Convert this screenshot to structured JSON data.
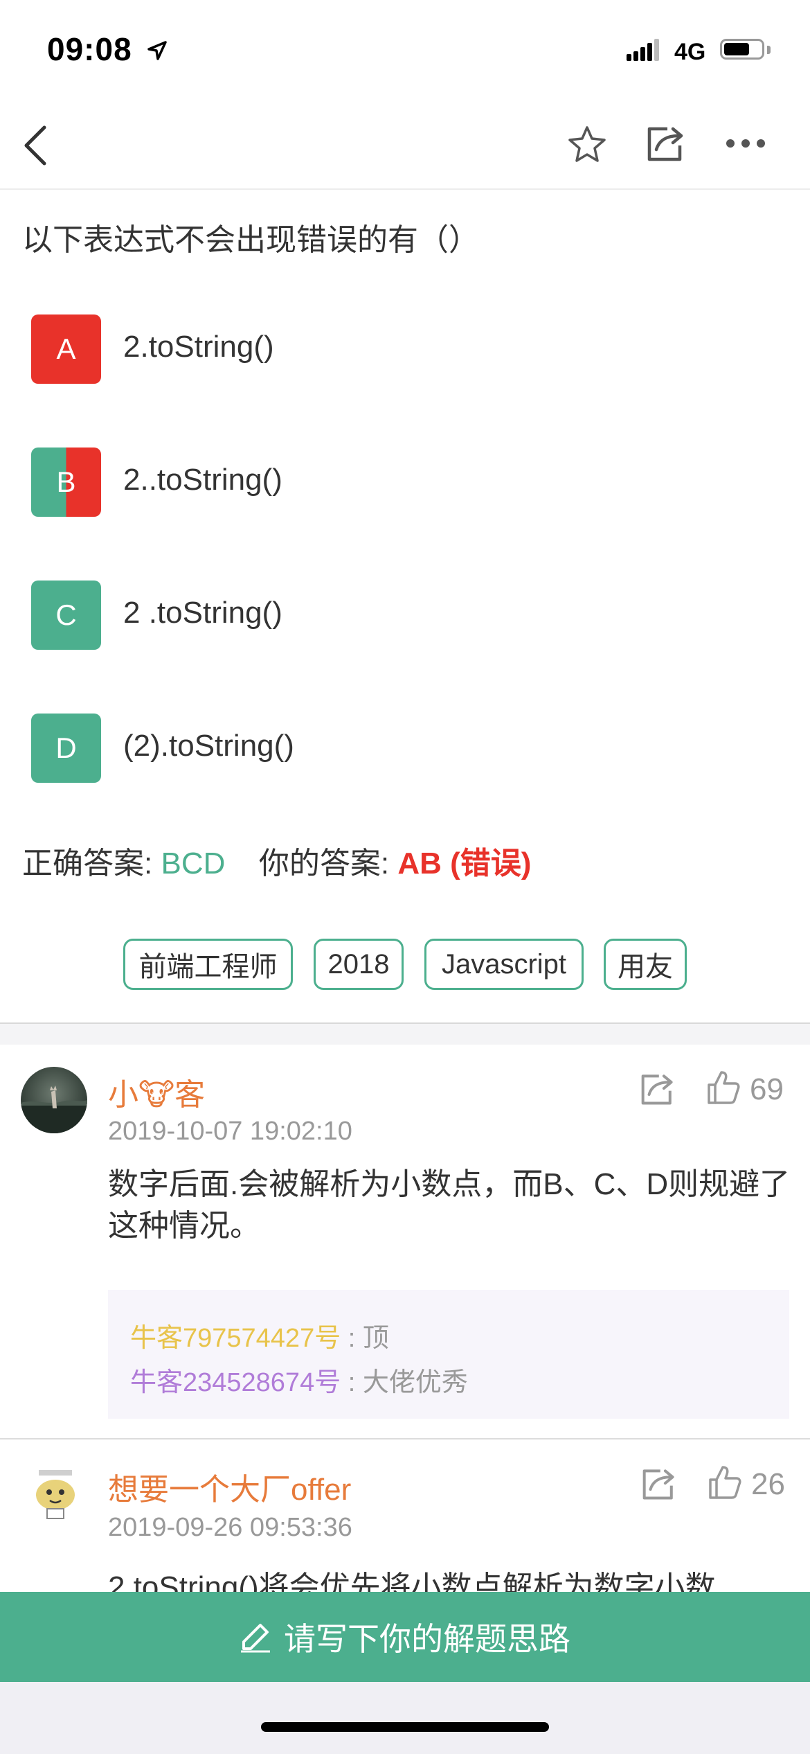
{
  "status_bar": {
    "time": "09:08",
    "network": "4G"
  },
  "nav": {
    "icons": [
      "back-icon",
      "star-icon",
      "share-icon",
      "more-icon"
    ]
  },
  "question": {
    "text": "以下表达式不会出现错误的有（）",
    "options": [
      {
        "letter": "A",
        "text": "2.toString()",
        "state": "wrong"
      },
      {
        "letter": "B",
        "text": "2..toString()",
        "state": "half"
      },
      {
        "letter": "C",
        "text": "2 .toString()",
        "state": "correct"
      },
      {
        "letter": "D",
        "text": "(2).toString()",
        "state": "correct"
      }
    ]
  },
  "answer": {
    "correct_label": "正确答案:",
    "correct_value": "BCD",
    "yours_label": "你的答案:",
    "yours_value": "AB (错误)"
  },
  "tags": [
    "前端工程师",
    "2018",
    "Javascript",
    "用友"
  ],
  "comments": [
    {
      "name": "小🐮客",
      "date": "2019-10-07 19:02:10",
      "likes": "69",
      "body": "数字后面.会被解析为小数点，而B、C、D则规避了这种情况。",
      "replies": [
        {
          "user": "牛客797574427号",
          "sep": " : ",
          "text": "顶",
          "user_color": "#e8c34a"
        },
        {
          "user": "牛客234528674号",
          "sep": " : ",
          "text": "大佬优秀",
          "user_color": "#b07cd8"
        }
      ]
    },
    {
      "name": "想要一个大厂offer",
      "date": "2019-09-26 09:53:36",
      "likes": "26",
      "body": "2.toString()将会优先将小数点解析为数字小数"
    }
  ],
  "write_button": "请写下你的解题思路",
  "colors": {
    "green": "#4caf8e",
    "red": "#e8322a",
    "orange": "#e77b3b"
  }
}
